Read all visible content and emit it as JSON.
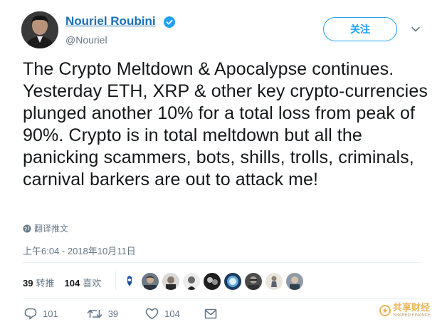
{
  "author": {
    "name": "Nouriel Roubini",
    "handle": "@Nouriel"
  },
  "follow_button": {
    "label": "关注"
  },
  "tweet": {
    "text": "The Crypto Meltdown & Apocalypse continues. Yesterday ETH, XRP & other key crypto-currencies plunged another 10% for a total loss from peak of 90%. Crypto is in total meltdown but all the panicking scammers, bots, shills, trolls, criminals, carnival barkers are out to attack me!",
    "translate_label": "翻译推文",
    "timestamp": "上午6:04 - 2018年10月11日"
  },
  "stats": {
    "retweets_count": "39",
    "retweets_label": "转推",
    "likes_count": "104",
    "likes_label": "喜欢"
  },
  "actions": {
    "reply_count": "101",
    "retweet_count": "39",
    "like_count": "104"
  },
  "watermark": {
    "main": "共享财经",
    "sub": "SHARED FINANCE"
  },
  "colors": {
    "link_blue": "#1da1f2",
    "name_blue": "#1a6fb5",
    "muted": "#657786",
    "text": "#14171a"
  },
  "icons": [
    "verified-icon",
    "chevron-down-icon",
    "globe-icon",
    "reply-icon",
    "retweet-icon",
    "heart-icon",
    "message-icon"
  ]
}
